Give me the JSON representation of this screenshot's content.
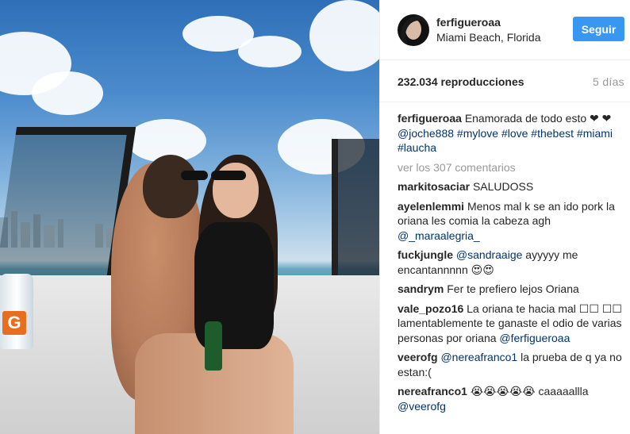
{
  "post": {
    "username": "ferfigueroaa",
    "location": "Miami Beach, Florida",
    "follow_label": "Seguir",
    "views": "232.034 reproducciones",
    "age": "5 días"
  },
  "caption": {
    "user": "ferfigueroaa",
    "text": "Enamorada de todo esto ❤ ❤ ",
    "tags_line": "@joche888 #mylove #love #thebest",
    "tags_line2": "#miami #laucha"
  },
  "view_all": "ver los 307 comentarios",
  "comments": [
    {
      "user": "markitosaciar",
      "text": "SALUDOSS"
    },
    {
      "user": "ayelenlemmi",
      "text": "Menos mal k se an ido pork la oriana les comia la cabeza agh ",
      "mention": "@_maraalegria_"
    },
    {
      "user": "fuckjungle",
      "mention": "@sandraaige",
      "text": " ayyyyy me encantannnnn 😍😍"
    },
    {
      "user": "sandrym",
      "text": "Fer te prefiero lejos Oriana"
    },
    {
      "user": "vale_pozo16",
      "text": "La oriana te hacia mal ☐☐ ☐☐ lamentablemente te ganaste el odio de varias personas por oriana ",
      "mention": "@ferfigueroaa"
    },
    {
      "user": "veerofg",
      "mention": "@nereafranco1",
      "text": " la prueba de q ya no estan:("
    },
    {
      "user": "nereafranco1",
      "text": "😭😭😭😭😭 caaaaallla ",
      "mention": "@veerofg"
    }
  ],
  "photo": {
    "bottle_label": "G"
  }
}
